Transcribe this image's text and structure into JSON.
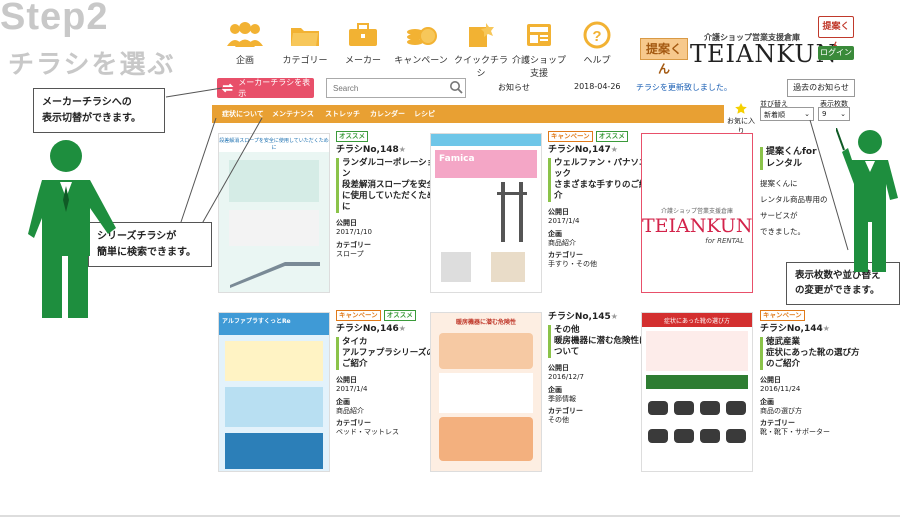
{
  "heading": {
    "step": "Step2",
    "subtitle": "チラシを選ぶ"
  },
  "nav": [
    {
      "label": "企画",
      "icon": "people-icon"
    },
    {
      "label": "カテゴリー",
      "icon": "folder-icon"
    },
    {
      "label": "メーカー",
      "icon": "briefcase-icon"
    },
    {
      "label": "キャンペーン",
      "icon": "coins-icon"
    },
    {
      "label": "クイックチラシ",
      "icon": "quick-flyer-icon"
    },
    {
      "label": "介護ショップ支援",
      "icon": "news-icon"
    },
    {
      "label": "ヘルプ",
      "icon": "help-icon"
    }
  ],
  "logo": {
    "badge": "提案くん",
    "sub": "介護ショップ営業支援倉庫",
    "main": "TEIANKUN"
  },
  "account": {
    "badge": "提案くん",
    "login": "ログイン"
  },
  "toolbar": {
    "maker_button": "メーカーチラシを表示",
    "search_placeholder": "Search"
  },
  "news": {
    "label": "お知らせ",
    "date": "2018-04-26",
    "text": "チラシを更新致しました。",
    "past_button": "過去のお知らせ"
  },
  "categories": [
    "症状について",
    "メンテナンス",
    "ストレッチ",
    "カレンダー",
    "レシピ"
  ],
  "favorites": "お気に入り",
  "sort": {
    "label": "並び替え",
    "value": "新着順"
  },
  "count": {
    "label": "表示枚数",
    "value": "9"
  },
  "labels": {
    "published": "公開日",
    "plan": "企画",
    "category": "カテゴリー"
  },
  "cards": [
    {
      "tags": [
        {
          "t": "オススメ",
          "c": "rec"
        }
      ],
      "number": "チラシNo,148",
      "title": "ランダルコーポレーション\n段差解消スロープを安全に使用していただくために",
      "date": "2017/1/10",
      "plan": "",
      "category": "スロープ",
      "thumb_title": "段差解消スロープを安全に使用していただくために"
    },
    {
      "tags": [
        {
          "t": "キャンペーン",
          "c": "camp"
        },
        {
          "t": "オススメ",
          "c": "rec"
        }
      ],
      "number": "チラシNo,147",
      "title": "ウェルファン・パナソニック\nさまざまな手すりのご紹介",
      "date": "2017/1/4",
      "plan": "商品紹介",
      "category": "手すり・その他",
      "thumb_title": "Famica"
    },
    {
      "tags": [],
      "number": "",
      "title": "提案くんfor\nレンタル",
      "desc": [
        "提案くんに",
        "レンタル商品専用の",
        "サービスが",
        "できました。"
      ],
      "thumb_sub": "介護ショップ営業支援倉庫",
      "thumb_main": "TEIANKUN",
      "thumb_rental": "for RENTAL"
    },
    {
      "tags": [
        {
          "t": "キャンペーン",
          "c": "camp"
        },
        {
          "t": "オススメ",
          "c": "rec"
        }
      ],
      "number": "チラシNo,146",
      "title": "タイカ\nアルファプラシリーズのご紹介",
      "date": "2017/1/4",
      "plan": "商品紹介",
      "category": "ベッド・マットレス",
      "thumb_title": "アルファプラすくっとRe"
    },
    {
      "tags": [],
      "number": "チラシNo,145",
      "title": "その他\n暖房機器に潜む危険性について",
      "date": "2016/12/7",
      "plan": "季節情報",
      "category": "その他",
      "thumb_title": "暖房機器に潜む危険性"
    },
    {
      "tags": [
        {
          "t": "キャンペーン",
          "c": "camp"
        }
      ],
      "number": "チラシNo,144",
      "title": "徳武産業\n症状にあった靴の選び方のご紹介",
      "date": "2016/11/24",
      "plan": "商品の選び方",
      "category": "靴・靴下・サポーター",
      "thumb_title": "症状にあった靴の選び方"
    }
  ],
  "callouts": {
    "maker": "メーカーチラシへの\n表示切替ができます。",
    "series": "シリーズチラシが\n簡単に検索できます。",
    "sort": "表示枚数や並び替え\nの変更ができます。"
  },
  "colors": {
    "orange_bar": "#e8a033",
    "maker_button": "#e8506a",
    "figure_green": "#1e8e3e",
    "accent_green": "#8bc34a"
  }
}
